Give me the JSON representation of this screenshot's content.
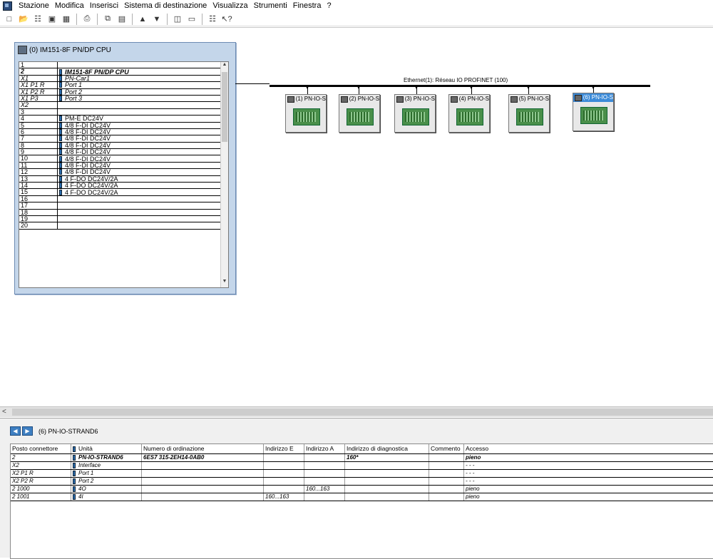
{
  "menu": [
    "Stazione",
    "Modifica",
    "Inserisci",
    "Sistema di destinazione",
    "Visualizza",
    "Strumenti",
    "Finestra",
    "?"
  ],
  "toolbar": {
    "icons": [
      "new-icon",
      "open-icon",
      "network-icon",
      "save-icon",
      "compile-icon",
      "print-icon",
      "copy-icon",
      "paste-icon",
      "download-icon",
      "upload-icon",
      "catalog-icon",
      "window-icon",
      "netpro-icon",
      "help-pointer-icon"
    ]
  },
  "rack": {
    "title": "(0) IM151-8F PN/DP CPU",
    "rows": [
      {
        "slot": "1",
        "name": ""
      },
      {
        "slot": "2",
        "name": "IM151-8F PN/DP CPU"
      },
      {
        "slot": "X1",
        "name": "PN-Car1"
      },
      {
        "slot": "X1 P1 R",
        "name": "Port 1"
      },
      {
        "slot": "X1 P2 R",
        "name": "Port 2"
      },
      {
        "slot": "X1 P3",
        "name": "Port 3"
      },
      {
        "slot": "X2",
        "name": ""
      },
      {
        "slot": "3",
        "name": ""
      },
      {
        "slot": "4",
        "name": "PM-E DC24V"
      },
      {
        "slot": "5",
        "name": "4/8 F-DI DC24V"
      },
      {
        "slot": "6",
        "name": "4/8 F-DI DC24V"
      },
      {
        "slot": "7",
        "name": "4/8 F-DI DC24V"
      },
      {
        "slot": "8",
        "name": "4/8 F-DI DC24V"
      },
      {
        "slot": "9",
        "name": "4/8 F-DI DC24V"
      },
      {
        "slot": "10",
        "name": "4/8 F-DI DC24V"
      },
      {
        "slot": "11",
        "name": "4/8 F-DI DC24V"
      },
      {
        "slot": "12",
        "name": "4/8 F-DI DC24V"
      },
      {
        "slot": "13",
        "name": "4 F-DO DC24V/2A"
      },
      {
        "slot": "14",
        "name": "4 F-DO DC24V/2A"
      },
      {
        "slot": "15",
        "name": "4 F-DO DC24V/2A"
      },
      {
        "slot": "16",
        "name": ""
      },
      {
        "slot": "17",
        "name": ""
      },
      {
        "slot": "18",
        "name": ""
      },
      {
        "slot": "19",
        "name": ""
      },
      {
        "slot": "20",
        "name": ""
      }
    ]
  },
  "network": {
    "label": "Ethernet(1): Réseau IO PROFINET (100)",
    "nodes": [
      "(1) PN-IO-S",
      "(2) PN-IO-S",
      "(3) PN-IO-S",
      "(4) PN-IO-S",
      "(5) PN-IO-S",
      "(6) PN-IO-S"
    ],
    "selected_node": "(6) PN-IO-S"
  },
  "detail": {
    "title": "(6)   PN-IO-STRAND6",
    "columns": [
      "Posto connettore",
      "Unità",
      "Numero di ordinazione",
      "Indirizzo E",
      "Indirizzo A",
      "Indirizzo di diagnostica",
      "Commento",
      "Accesso"
    ],
    "rows": [
      {
        "slot": "2",
        "unit": "PN-IO-STRAND6",
        "order": "6ES7 315-2EH14-0AB0",
        "in": "",
        "out": "",
        "diag": "160*",
        "comment": "",
        "access": "pieno"
      },
      {
        "slot": "X2",
        "unit": "Interface",
        "order": "",
        "in": "",
        "out": "",
        "diag": "",
        "comment": "",
        "access": "- - -"
      },
      {
        "slot": "X2 P1 R",
        "unit": "Port 1",
        "order": "",
        "in": "",
        "out": "",
        "diag": "",
        "comment": "",
        "access": "- - -"
      },
      {
        "slot": "X2 P2 R",
        "unit": "Port 2",
        "order": "",
        "in": "",
        "out": "",
        "diag": "",
        "comment": "",
        "access": "- - -"
      },
      {
        "slot": "2 1000",
        "unit": "4O",
        "order": "",
        "in": "",
        "out": "160...163",
        "diag": "",
        "comment": "",
        "access": "pieno"
      },
      {
        "slot": "2 1001",
        "unit": "4I",
        "order": "",
        "in": "160...163",
        "out": "",
        "diag": "",
        "comment": "",
        "access": "pieno"
      }
    ]
  }
}
